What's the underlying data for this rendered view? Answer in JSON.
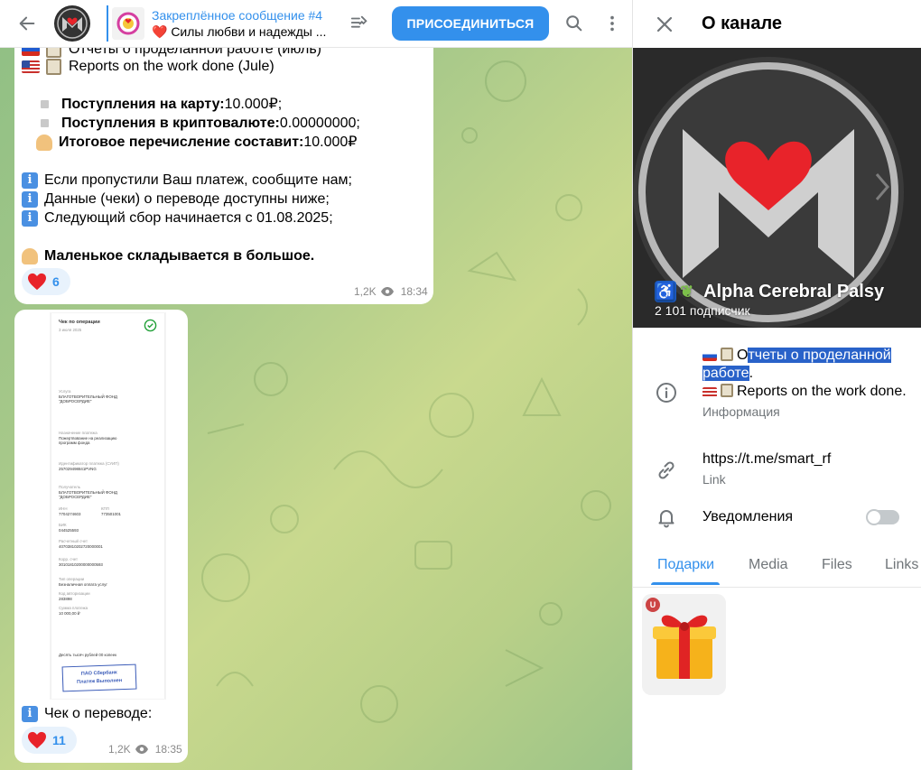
{
  "header": {
    "pinned_title": "Закреплённое сообщение #4",
    "pinned_preview": "❤️ Силы любви и надежды ...",
    "join_label": "ПРИСОЕДИНИТЬСЯ"
  },
  "message1": {
    "line_top_partial": "Отчеты о проделанной работе (июль)",
    "line_en": "Reports on the work done (Jule)",
    "card_label": "Поступления на карту:",
    "card_value": " 10.000₽;",
    "crypto_label": "Поступления в криптовалюте:",
    "crypto_value": " 0.00000000;",
    "total_label": "Итоговое перечисление составит:",
    "total_value": " 10.000₽",
    "info1": "Если пропустили Ваш платеж, сообщите нам;",
    "info2": "Данные (чеки) о переводе доступны ниже;",
    "info3": "Следующий сбор начинается с 01.08.2025;",
    "closing": "Маленькое складывается в большое.",
    "reaction_count": "6",
    "views": "1,2K",
    "time": "18:34"
  },
  "message2": {
    "receipt": {
      "title": "Чек по операции",
      "date": "3 июля 2025",
      "l1": "Услуга",
      "v1a": "БЛАГОТВОРИТЕЛЬНЫЙ ФОНД",
      "v1b": "\"ДОБРОСЕРДИЕ\"",
      "l2": "Назначение платежа",
      "v2a": "Пожертвование на реализацию",
      "v2b": "программ фонда",
      "l3": "Идентификатор платежа (СУИП)",
      "v3": "257029498841PVNG",
      "l4": "Получатель",
      "v4a": "БЛАГОТВОРИТЕЛЬНЫЙ ФОНД",
      "v4b": "\"ДОБРОСЕРДИЕ\"",
      "l5a": "ИНН",
      "l5b": "КПП",
      "v5a": "7704274603",
      "v5b": "773501001",
      "l6": "БИК",
      "v6": "044525593",
      "l7": "Расчетный счет",
      "v7": "40703810202720000001",
      "l8": "Корр. счет",
      "v8": "30101810200000000593",
      "l9": "Тип операции",
      "v9": "Безналичная оплата услуг",
      "l10": "Код авторизации",
      "v10": "283898",
      "l11": "Сумма платежа",
      "v11": "10 000,00 ₽",
      "amount_words": "Десять тысяч рублей 00 копеек",
      "stamp1": "ПАО Сбербанк",
      "stamp2": "Платеж Выполнен"
    },
    "caption": "Чек о переводе:",
    "reaction_count": "11",
    "views": "1,2K",
    "time": "18:35"
  },
  "panel": {
    "title": "О канале",
    "channel_name": "Alpha Cerebral Palsy",
    "subscribers": "2 101 подписчик",
    "desc_o": "О",
    "desc_hl1": "тчеты о проделанной",
    "desc_hl2": "работе",
    "desc_dot": ".",
    "desc_en": "Reports on the work done.",
    "desc_label": "Информация",
    "link": "https://t.me/smart_rf",
    "link_label": "Link",
    "notifications": "Уведомления",
    "tabs": [
      "Подарки",
      "Media",
      "Files",
      "Links"
    ],
    "gift_badge": "U"
  },
  "colors": {
    "accent": "#3390ec",
    "heart": "#e8232a",
    "selection": "#2962c9"
  }
}
